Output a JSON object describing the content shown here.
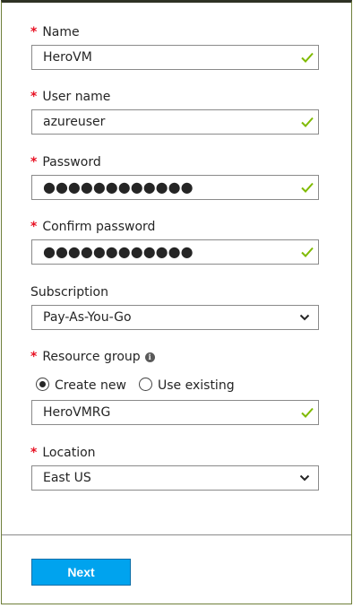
{
  "form": {
    "name": {
      "label": "Name",
      "value": "HeroVM",
      "valid": true
    },
    "username": {
      "label": "User name",
      "value": "azureuser",
      "valid": true
    },
    "password": {
      "label": "Password",
      "value": "●●●●●●●●●●●●",
      "valid": true
    },
    "confirm_password": {
      "label": "Confirm password",
      "value": "●●●●●●●●●●●●",
      "valid": true
    },
    "subscription": {
      "label": "Subscription",
      "value": "Pay-As-You-Go"
    },
    "resource_group": {
      "label": "Resource group",
      "info_icon": "i",
      "options": {
        "create_new": "Create new",
        "use_existing": "Use existing"
      },
      "selected": "create_new",
      "value": "HeroVMRG",
      "valid": true
    },
    "location": {
      "label": "Location",
      "value": "East US"
    },
    "required_marker": "*"
  },
  "footer": {
    "next_label": "Next"
  },
  "colors": {
    "required": "#e81123",
    "check": "#7fba00",
    "button": "#00a3ee",
    "border": "#8a8a8a"
  },
  "icons": {
    "valid": "checkmark-icon",
    "dropdown": "chevron-down-icon",
    "info": "info-icon"
  }
}
